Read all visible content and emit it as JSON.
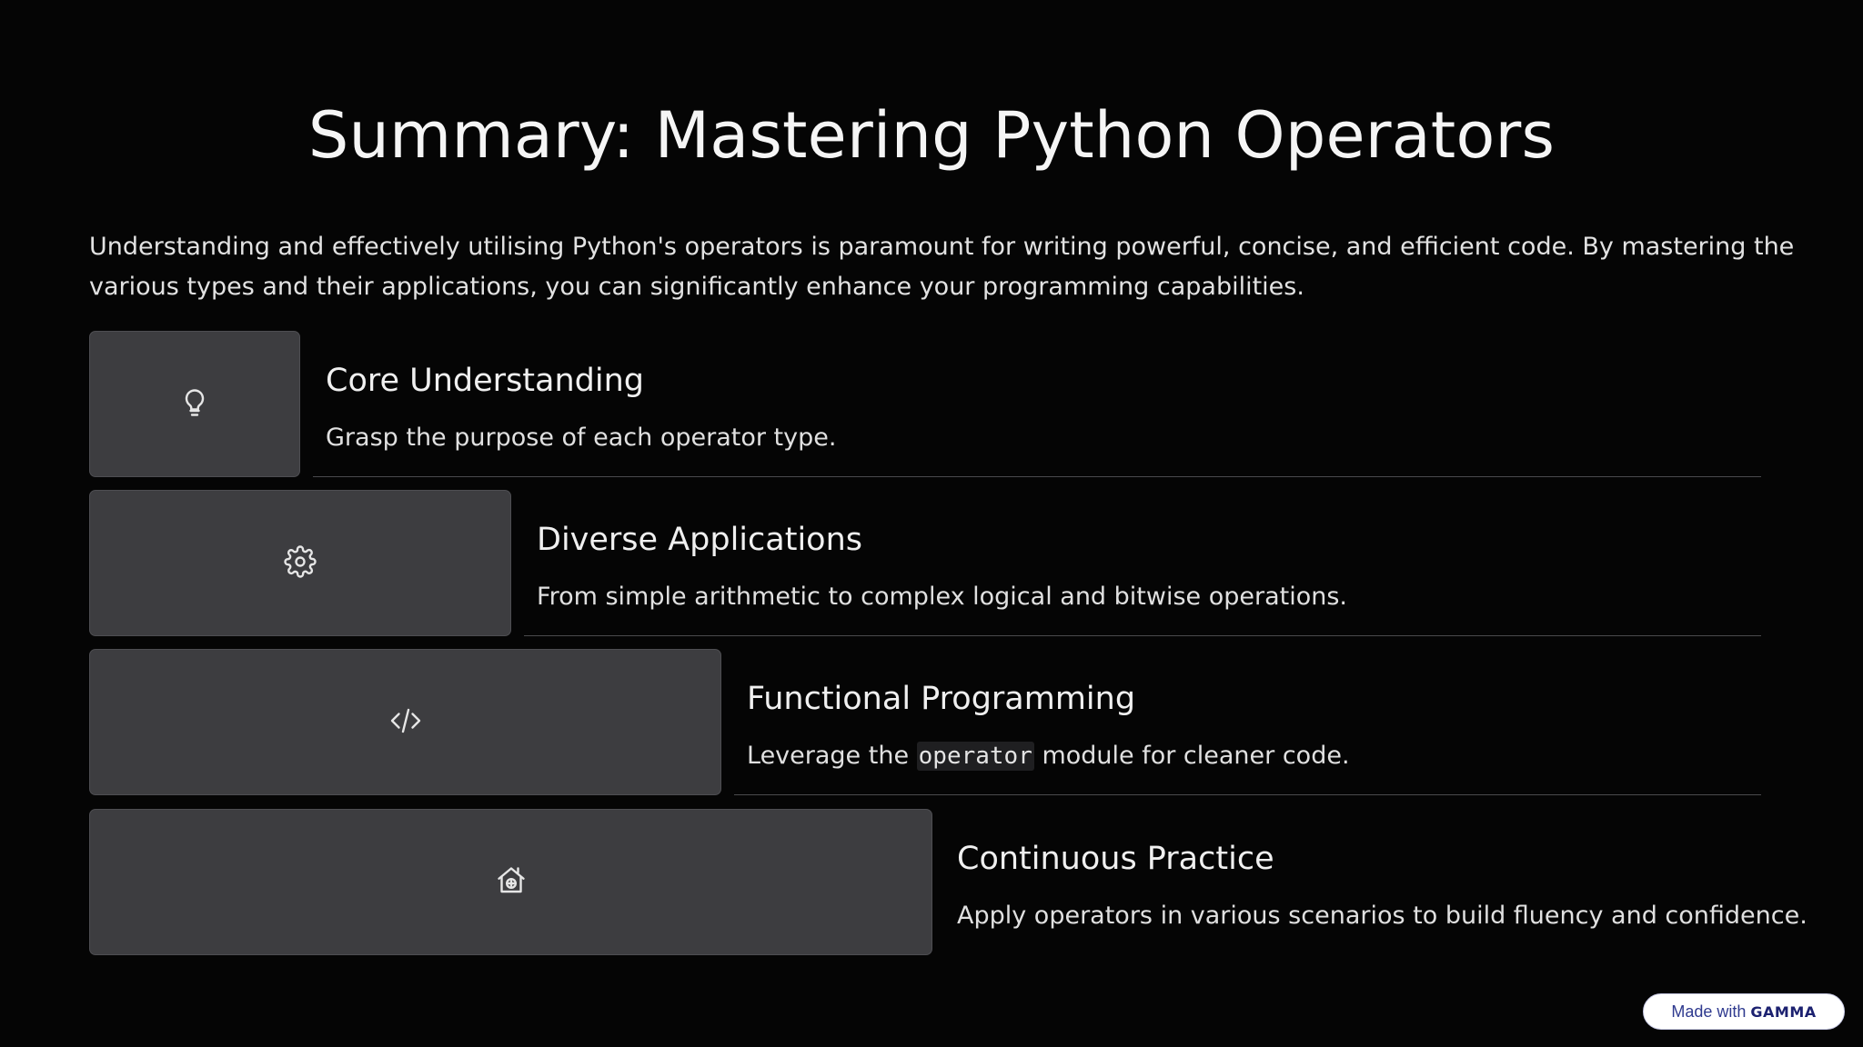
{
  "slide": {
    "title": "Summary: Mastering Python Operators",
    "intro": "Understanding and effectively utilising Python's operators is paramount for writing powerful, concise, and efficient code. By mastering the various types and their applications, you can significantly enhance your programming capabilities."
  },
  "steps": [
    {
      "icon": "lightbulb-icon",
      "title": "Core Understanding",
      "description": "Grasp the purpose of each operator type."
    },
    {
      "icon": "gear-icon",
      "title": "Diverse Applications",
      "description": "From simple arithmetic to complex logical and bitwise operations."
    },
    {
      "icon": "code-icon",
      "title": "Functional Programming",
      "description_before": "Leverage the ",
      "description_code": "operator",
      "description_after": " module for cleaner code."
    },
    {
      "icon": "house-plus-icon",
      "title": "Continuous Practice",
      "description": "Apply operators in various scenarios to build fluency and confidence."
    }
  ],
  "badge": {
    "prefix": "Made with",
    "brand": "GAMMA"
  }
}
